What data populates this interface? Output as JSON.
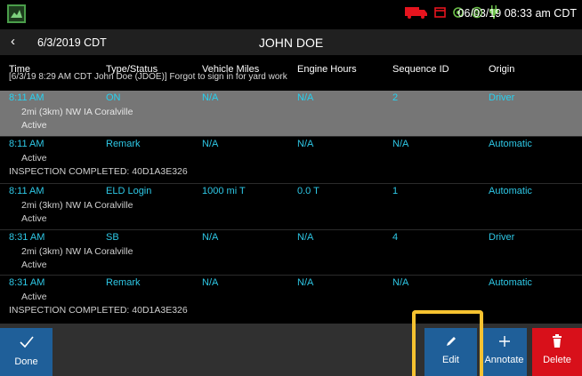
{
  "statusbar": {
    "datetime": "06/03/19 08:33 am CDT",
    "icons": [
      "truck-icon",
      "calendar-icon",
      "gps-icon",
      "wifi-icon",
      "power-icon"
    ],
    "colors": {
      "truck": "#e6141e",
      "calendar": "#e6141e",
      "gps": "#6cc04a",
      "wifi": "#6cc04a",
      "power": "#6cc04a"
    }
  },
  "navbar": {
    "date": "6/3/2019 CDT",
    "driver": "JOHN DOE"
  },
  "table": {
    "headers": {
      "time": "Time",
      "type": "Type/Status",
      "miles": "Vehicle Miles",
      "hours": "Engine Hours",
      "seq": "Sequence ID",
      "origin": "Origin"
    },
    "annotation": "[6/3/19 8:29 AM CDT John Doe (JDOE)] Forgot to sign in for yard work",
    "rows": [
      {
        "time": "8:11 AM",
        "type": "ON",
        "miles": "N/A",
        "hours": "N/A",
        "seq": "2",
        "origin": "Driver",
        "location": "2mi (3km) NW IA Coralville",
        "status": "Active",
        "note": ""
      },
      {
        "time": "8:11 AM",
        "type": "Remark",
        "miles": "N/A",
        "hours": "N/A",
        "seq": "N/A",
        "origin": "Automatic",
        "location": "",
        "status": "Active",
        "note": "INSPECTION COMPLETED: 40D1A3E326"
      },
      {
        "time": "8:11 AM",
        "type": "ELD Login",
        "miles": "1000 mi T",
        "hours": "0.0 T",
        "seq": "1",
        "origin": "Automatic",
        "location": "2mi (3km) NW IA Coralville",
        "status": "Active",
        "note": ""
      },
      {
        "time": "8:31 AM",
        "type": "SB",
        "miles": "N/A",
        "hours": "N/A",
        "seq": "4",
        "origin": "Driver",
        "location": "2mi (3km) NW IA Coralville",
        "status": "Active",
        "note": ""
      },
      {
        "time": "8:31 AM",
        "type": "Remark",
        "miles": "N/A",
        "hours": "N/A",
        "seq": "N/A",
        "origin": "Automatic",
        "location": "",
        "status": "Active",
        "note": "INSPECTION COMPLETED: 40D1A3E326"
      }
    ]
  },
  "toolbar": {
    "done": "Done",
    "edit": "Edit",
    "annotate": "Annotate",
    "delete": "Delete"
  },
  "colors": {
    "accent_text": "#2ec8e6",
    "selected_row": "#767676",
    "button_blue": "#1f5f99",
    "button_red": "#d8101a",
    "highlight": "#f6c230"
  }
}
